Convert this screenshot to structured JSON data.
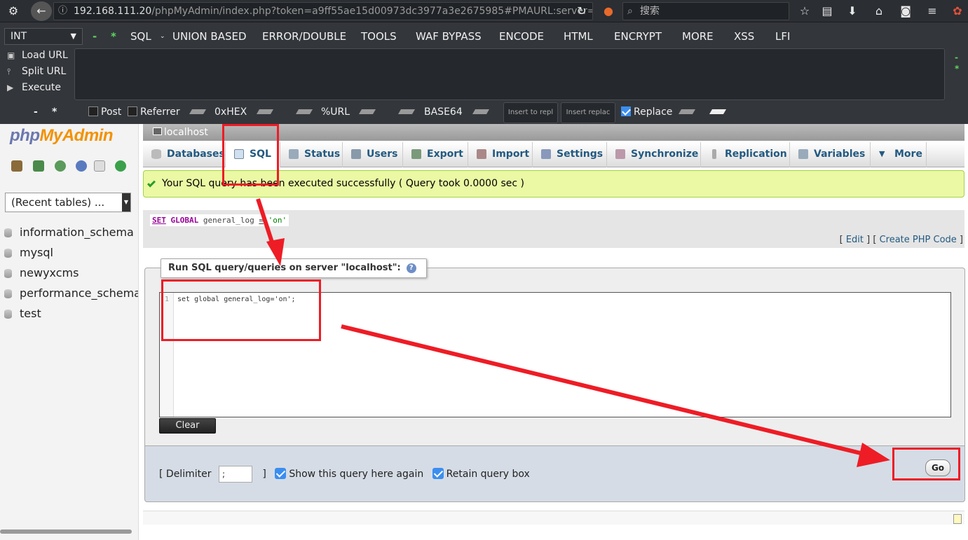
{
  "browser": {
    "url_host": "192.168.111.20",
    "url_path": "/phpMyAdmin/index.php?token=a9ff55ae15d00973dc3977a3e2675985#PMAURL:server=",
    "search_placeholder": "搜索"
  },
  "hackbar": {
    "int_select": "INT",
    "menu": [
      "SQL",
      "UNION BASED",
      "ERROR/DOUBLE",
      "TOOLS",
      "WAF BYPASS",
      "ENCODE",
      "HTML",
      "ENCRYPT",
      "MORE",
      "XSS",
      "LFI"
    ],
    "side": [
      "Load URL",
      "Split URL",
      "Execute"
    ],
    "post": "Post",
    "referrer": "Referrer",
    "hex": "0xHEX",
    "url": "%URL",
    "base64": "BASE64",
    "insert1": "Insert to repl",
    "insert2": "Insert replac",
    "replace": "Replace"
  },
  "pma": {
    "logo": {
      "php": "php",
      "my": "My",
      "admin": "Admin"
    },
    "recent_tables": "(Recent tables) ...",
    "databases": [
      "information_schema",
      "mysql",
      "newyxcms",
      "performance_schema",
      "test"
    ],
    "server": "localhost",
    "tabs": [
      "Databases",
      "SQL",
      "Status",
      "Users",
      "Export",
      "Import",
      "Settings",
      "Synchronize",
      "Replication",
      "Variables",
      "More"
    ],
    "success_message": "Your SQL query has been executed successfully ( Query took 0.0000 sec )",
    "executed": {
      "kw1": "SET",
      "kw2": "GLOBAL",
      "rest": "general_log",
      "eq": "=",
      "val": "'on'"
    },
    "links": {
      "open": "[",
      "edit": "Edit",
      "mid": "] [",
      "php": "Create PHP Code",
      "close": "]"
    },
    "run_title": "Run SQL query/queries on server \"localhost\":",
    "editor_line": "1",
    "editor_code": "set global general_log='on';",
    "clear": "Clear",
    "delimiter_label": "[ Delimiter",
    "delimiter_value": ";",
    "delimiter_close": "]",
    "show_query": "Show this query here again",
    "retain": "Retain query box",
    "go": "Go"
  }
}
